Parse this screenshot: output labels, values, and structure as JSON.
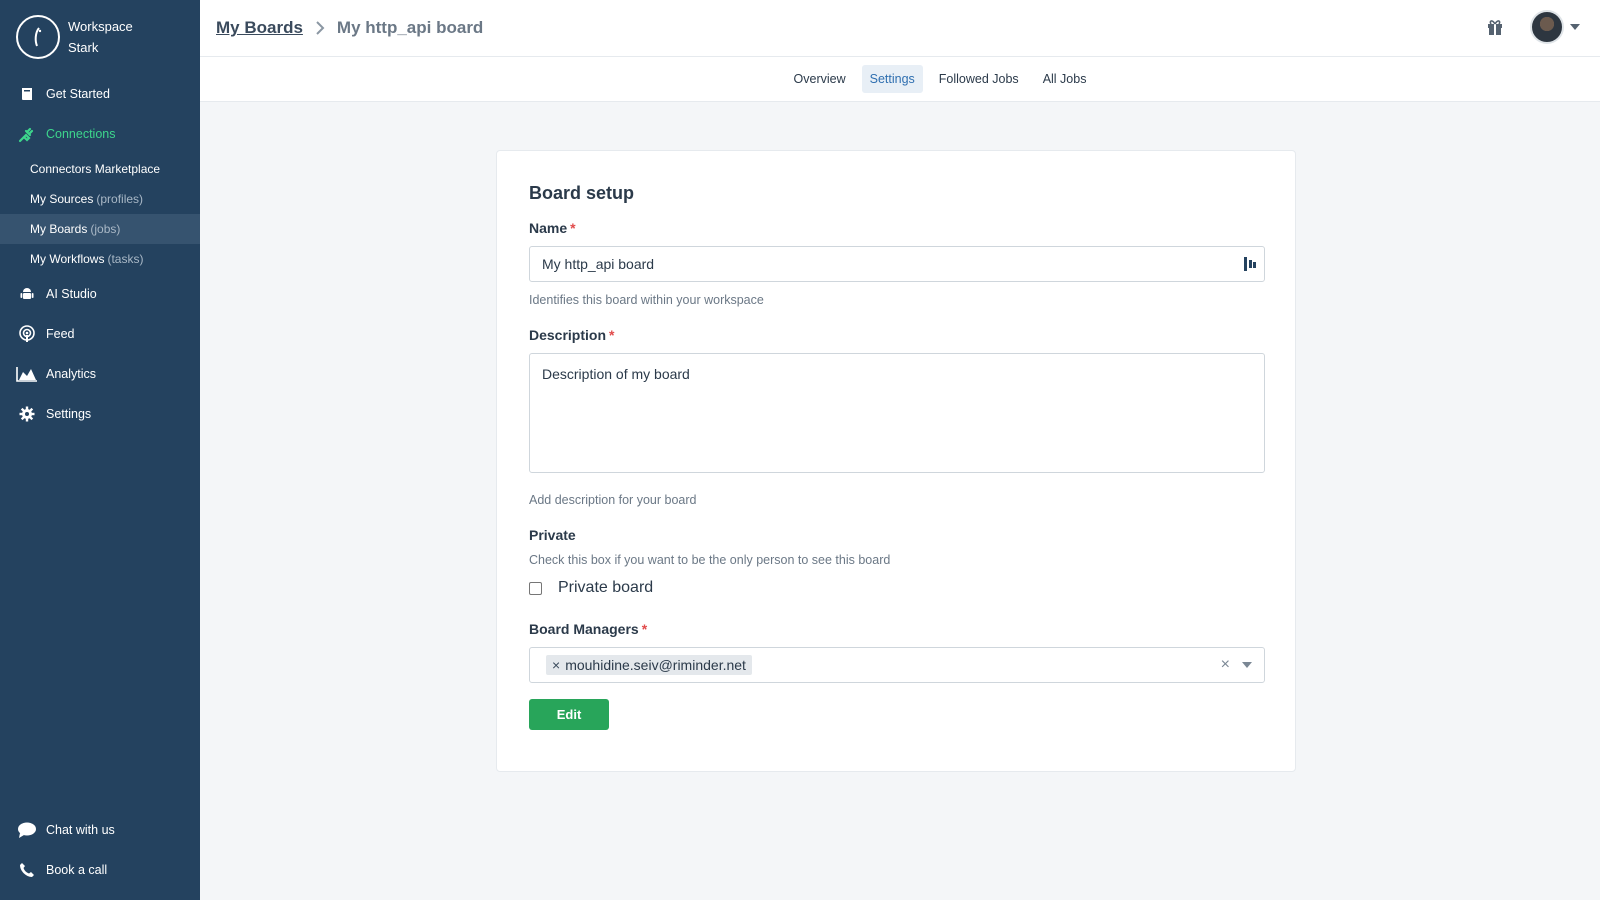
{
  "brand": {
    "line1": "Workspace",
    "line2": "Stark"
  },
  "sidebar": {
    "items": [
      {
        "label": "Get Started",
        "icon": "book-icon"
      },
      {
        "label": "Connections",
        "icon": "plug-icon"
      },
      {
        "label": "AI Studio",
        "icon": "android-icon"
      },
      {
        "label": "Feed",
        "icon": "podcast-icon"
      },
      {
        "label": "Analytics",
        "icon": "area-chart-icon"
      },
      {
        "label": "Settings",
        "icon": "gear-icon"
      }
    ],
    "subitems": [
      {
        "label": "Connectors Marketplace",
        "muted": ""
      },
      {
        "label": "My Sources",
        "muted": "(profiles)"
      },
      {
        "label": "My Boards",
        "muted": "(jobs)"
      },
      {
        "label": "My Workflows",
        "muted": "(tasks)"
      }
    ],
    "bottom": [
      {
        "label": "Chat with us",
        "icon": "chat-icon"
      },
      {
        "label": "Book a call",
        "icon": "phone-icon"
      }
    ]
  },
  "breadcrumb": {
    "parent": "My Boards",
    "current": "My http_api board"
  },
  "tabs": [
    "Overview",
    "Settings",
    "Followed Jobs",
    "All Jobs"
  ],
  "form": {
    "title": "Board setup",
    "name_label": "Name",
    "name_value": "My http_api board",
    "name_help": "Identifies this board within your workspace",
    "desc_label": "Description",
    "desc_value": "Description of my board",
    "desc_help": "Add description for your board",
    "private_label": "Private",
    "private_help": "Check this box if you want to be the only person to see this board",
    "private_checkbox_label": "Private board",
    "managers_label": "Board Managers",
    "manager_tag": "mouhidine.seiv@riminder.net",
    "submit_label": "Edit",
    "required_mark": "*"
  },
  "colors": {
    "sidebar": "#24425f",
    "active": "#3dd68c",
    "primary_button": "#28a55a",
    "required": "#e14b4b"
  }
}
